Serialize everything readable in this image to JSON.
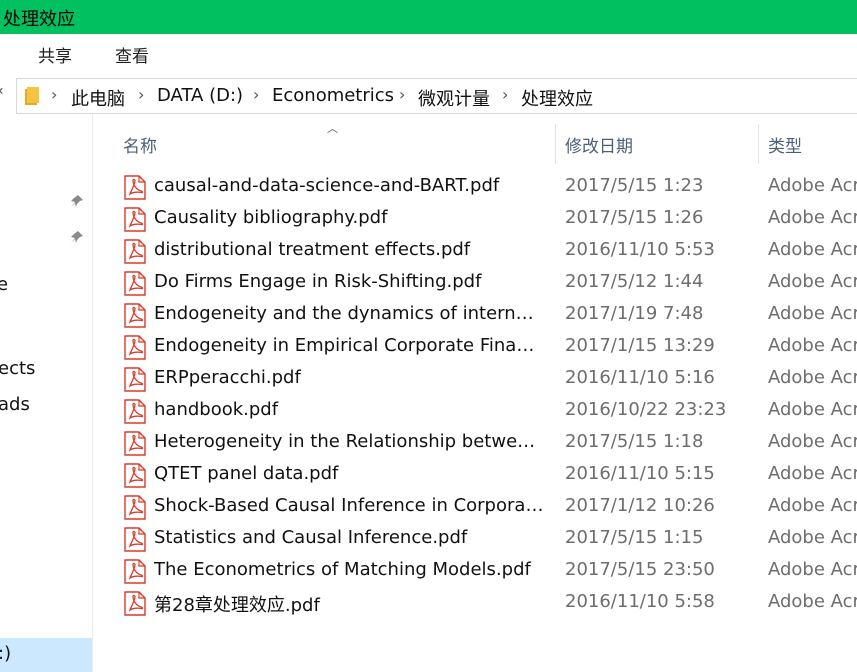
{
  "window": {
    "title": "处理效应"
  },
  "ribbon": {
    "tabs": [
      "共享",
      "查看"
    ]
  },
  "address": {
    "crumbs": [
      "此电脑",
      "DATA (D:)",
      "Econometrics",
      "微观计量",
      "处理效应"
    ]
  },
  "nav": {
    "items": [
      "e",
      "ects",
      "ads",
      ":)"
    ]
  },
  "columns": {
    "name": "名称",
    "date": "修改日期",
    "type": "类型"
  },
  "files": [
    {
      "name": "causal-and-data-science-and-BART.pdf",
      "date": "2017/5/15 1:23",
      "type": "Adobe Acr"
    },
    {
      "name": "Causality bibliography.pdf",
      "date": "2017/5/15 1:26",
      "type": "Adobe Acr"
    },
    {
      "name": "distributional treatment effects.pdf",
      "date": "2016/11/10 5:53",
      "type": "Adobe Acr"
    },
    {
      "name": "Do Firms Engage in Risk-Shifting.pdf",
      "date": "2017/5/12 1:44",
      "type": "Adobe Acr"
    },
    {
      "name": "Endogeneity and the dynamics of internal c...",
      "date": "2017/1/19 7:48",
      "type": "Adobe Acr"
    },
    {
      "name": "Endogeneity in Empirical Corporate Finance...",
      "date": "2017/1/15 13:29",
      "type": "Adobe Acr"
    },
    {
      "name": "ERPperacchi.pdf",
      "date": "2016/11/10 5:16",
      "type": "Adobe Acr"
    },
    {
      "name": "handbook.pdf",
      "date": "2016/10/22 23:23",
      "type": "Adobe Acr"
    },
    {
      "name": "Heterogeneity in the Relationship between ...",
      "date": "2017/5/15 1:18",
      "type": "Adobe Acr"
    },
    {
      "name": "QTET panel data.pdf",
      "date": "2016/11/10 5:15",
      "type": "Adobe Acr"
    },
    {
      "name": "Shock-Based Causal Inference in Corporate ...",
      "date": "2017/1/12 10:26",
      "type": "Adobe Acr"
    },
    {
      "name": "Statistics and Causal Inference.pdf",
      "date": "2017/5/15 1:15",
      "type": "Adobe Acr"
    },
    {
      "name": "The Econometrics of Matching Models.pdf",
      "date": "2017/5/15 23:50",
      "type": "Adobe Acr"
    },
    {
      "name": "第28章处理效应.pdf",
      "date": "2016/11/10 5:58",
      "type": "Adobe Acr"
    }
  ],
  "colors": {
    "titlebar": "#00c060",
    "pdf_red": "#d83b2b",
    "folder": "#f5c342",
    "selected": "#cce8ff"
  },
  "icons": {
    "folder": "folder-icon",
    "pdf": "pdf-file-icon",
    "pin": "pin-icon",
    "sort": "sort-up-arrow-icon",
    "chevron": "chevron-right-icon"
  }
}
